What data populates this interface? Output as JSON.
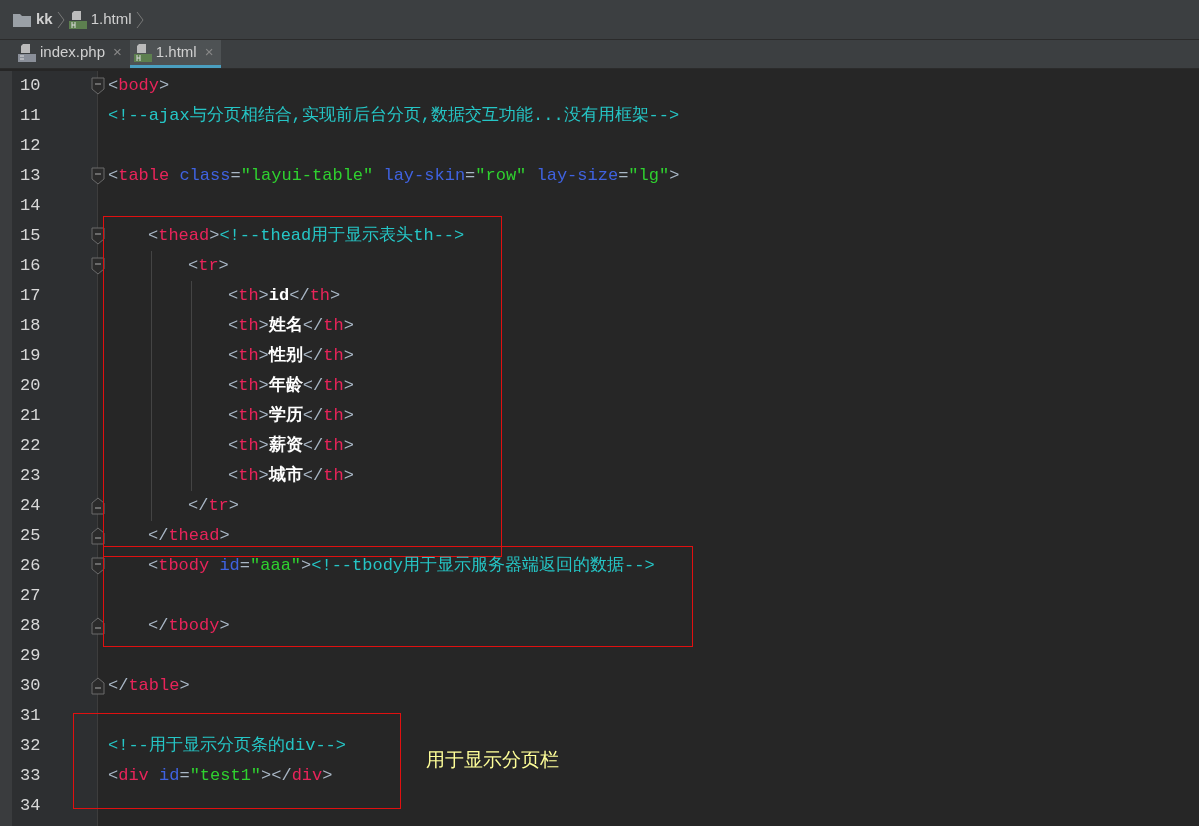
{
  "breadcrumb": [
    {
      "kind": "folder",
      "label": "kk"
    },
    {
      "kind": "html",
      "label": "1.html"
    }
  ],
  "tabs": [
    {
      "kind": "php",
      "label": "index.php",
      "close": "×",
      "selected": false
    },
    {
      "kind": "html",
      "label": "1.html",
      "close": "×",
      "selected": true
    }
  ],
  "lines": [
    {
      "kind": "open",
      "n": "10",
      "tokens": [
        {
          "kind": "br",
          "t": "<"
        },
        {
          "kind": "tag",
          "t": "body"
        },
        {
          "kind": "br",
          "t": ">"
        }
      ]
    },
    {
      "kind": "plain",
      "n": "11",
      "tokens": [
        {
          "kind": "comment",
          "t": "<!--ajax与分页相结合,实现前后台分页,数据交互功能...没有用框架-->"
        }
      ]
    },
    {
      "kind": "plain",
      "n": "12"
    },
    {
      "kind": "open",
      "n": "13",
      "tokens": [
        {
          "kind": "br",
          "t": "<"
        },
        {
          "kind": "tag",
          "t": "table "
        },
        {
          "kind": "attr",
          "t": "class"
        },
        {
          "kind": "br",
          "t": "="
        },
        {
          "kind": "str",
          "t": "\"layui-table\" "
        },
        {
          "kind": "attr",
          "t": "lay-skin"
        },
        {
          "kind": "br",
          "t": "="
        },
        {
          "kind": "str",
          "t": "\"row\" "
        },
        {
          "kind": "attr",
          "t": "lay-size"
        },
        {
          "kind": "br",
          "t": "="
        },
        {
          "kind": "str",
          "t": "\"lg\""
        },
        {
          "kind": "br",
          "t": ">"
        }
      ],
      "children": [
        {
          "kind": "plain",
          "n": "14"
        },
        {
          "kind": "box",
          "lines": [
            {
              "kind": "open",
              "n": "15",
              "tokens": [
                {
                  "kind": "br",
                  "t": "<"
                },
                {
                  "kind": "tag",
                  "t": "thead"
                },
                {
                  "kind": "br",
                  "t": ">"
                },
                {
                  "kind": "comment",
                  "t": "<!--thead用于显示表头th-->"
                }
              ],
              "children": [
                {
                  "kind": "open",
                  "n": "16",
                  "tokens": [
                    {
                      "kind": "br",
                      "t": "<"
                    },
                    {
                      "kind": "tag",
                      "t": "tr"
                    },
                    {
                      "kind": "br",
                      "t": ">"
                    }
                  ],
                  "children": [
                    {
                      "kind": "plain",
                      "n": "17",
                      "tokens": [
                        {
                          "kind": "br",
                          "t": "<"
                        },
                        {
                          "kind": "tag",
                          "t": "th"
                        },
                        {
                          "kind": "br",
                          "t": ">"
                        },
                        {
                          "kind": "text",
                          "t": "id"
                        },
                        {
                          "kind": "br",
                          "t": "</"
                        },
                        {
                          "kind": "tag",
                          "t": "th"
                        },
                        {
                          "kind": "br",
                          "t": ">"
                        }
                      ]
                    },
                    {
                      "kind": "plain",
                      "n": "18",
                      "tokens": [
                        {
                          "kind": "br",
                          "t": "<"
                        },
                        {
                          "kind": "tag",
                          "t": "th"
                        },
                        {
                          "kind": "br",
                          "t": ">"
                        },
                        {
                          "kind": "text",
                          "t": "姓名"
                        },
                        {
                          "kind": "br",
                          "t": "</"
                        },
                        {
                          "kind": "tag",
                          "t": "th"
                        },
                        {
                          "kind": "br",
                          "t": ">"
                        }
                      ]
                    },
                    {
                      "kind": "plain",
                      "n": "19",
                      "tokens": [
                        {
                          "kind": "br",
                          "t": "<"
                        },
                        {
                          "kind": "tag",
                          "t": "th"
                        },
                        {
                          "kind": "br",
                          "t": ">"
                        },
                        {
                          "kind": "text",
                          "t": "性别"
                        },
                        {
                          "kind": "br",
                          "t": "</"
                        },
                        {
                          "kind": "tag",
                          "t": "th"
                        },
                        {
                          "kind": "br",
                          "t": ">"
                        }
                      ]
                    },
                    {
                      "kind": "plain",
                      "n": "20",
                      "tokens": [
                        {
                          "kind": "br",
                          "t": "<"
                        },
                        {
                          "kind": "tag",
                          "t": "th"
                        },
                        {
                          "kind": "br",
                          "t": ">"
                        },
                        {
                          "kind": "text",
                          "t": "年龄"
                        },
                        {
                          "kind": "br",
                          "t": "</"
                        },
                        {
                          "kind": "tag",
                          "t": "th"
                        },
                        {
                          "kind": "br",
                          "t": ">"
                        }
                      ]
                    },
                    {
                      "kind": "plain",
                      "n": "21",
                      "tokens": [
                        {
                          "kind": "br",
                          "t": "<"
                        },
                        {
                          "kind": "tag",
                          "t": "th"
                        },
                        {
                          "kind": "br",
                          "t": ">"
                        },
                        {
                          "kind": "text",
                          "t": "学历"
                        },
                        {
                          "kind": "br",
                          "t": "</"
                        },
                        {
                          "kind": "tag",
                          "t": "th"
                        },
                        {
                          "kind": "br",
                          "t": ">"
                        }
                      ]
                    },
                    {
                      "kind": "plain",
                      "n": "22",
                      "tokens": [
                        {
                          "kind": "br",
                          "t": "<"
                        },
                        {
                          "kind": "tag",
                          "t": "th"
                        },
                        {
                          "kind": "br",
                          "t": ">"
                        },
                        {
                          "kind": "text",
                          "t": "薪资"
                        },
                        {
                          "kind": "br",
                          "t": "</"
                        },
                        {
                          "kind": "tag",
                          "t": "th"
                        },
                        {
                          "kind": "br",
                          "t": ">"
                        }
                      ]
                    },
                    {
                      "kind": "plain",
                      "n": "23",
                      "tokens": [
                        {
                          "kind": "br",
                          "t": "<"
                        },
                        {
                          "kind": "tag",
                          "t": "th"
                        },
                        {
                          "kind": "br",
                          "t": ">"
                        },
                        {
                          "kind": "text",
                          "t": "城市"
                        },
                        {
                          "kind": "br",
                          "t": "</"
                        },
                        {
                          "kind": "tag",
                          "t": "th"
                        },
                        {
                          "kind": "br",
                          "t": ">"
                        }
                      ]
                    }
                  ]
                },
                {
                  "kind": "close",
                  "n": "24",
                  "tokens": [
                    {
                      "kind": "br",
                      "t": "</"
                    },
                    {
                      "kind": "tag",
                      "t": "tr"
                    },
                    {
                      "kind": "br",
                      "t": ">"
                    }
                  ]
                }
              ]
            },
            {
              "kind": "close",
              "n": "25",
              "tokens": [
                {
                  "kind": "br",
                  "t": "</"
                },
                {
                  "kind": "tag",
                  "t": "thead"
                },
                {
                  "kind": "br",
                  "t": ">"
                }
              ]
            }
          ]
        },
        {
          "kind": "box",
          "lines": [
            {
              "kind": "open",
              "n": "26",
              "tokens": [
                {
                  "kind": "br",
                  "t": "<"
                },
                {
                  "kind": "tag",
                  "t": "tbody "
                },
                {
                  "kind": "attr",
                  "t": "id"
                },
                {
                  "kind": "br",
                  "t": "="
                },
                {
                  "kind": "str",
                  "t": "\"aaa\""
                },
                {
                  "kind": "br",
                  "t": ">"
                },
                {
                  "kind": "comment",
                  "t": "<!--tbody用于显示服务器端返回的数据-->"
                }
              ]
            },
            {
              "kind": "plain",
              "n": "27"
            },
            {
              "kind": "close",
              "n": "28",
              "tokens": [
                {
                  "kind": "br",
                  "t": "</"
                },
                {
                  "kind": "tag",
                  "t": "tbody"
                },
                {
                  "kind": "br",
                  "t": ">"
                }
              ]
            }
          ]
        },
        {
          "kind": "plain",
          "n": "29"
        }
      ]
    },
    {
      "kind": "close",
      "n": "30",
      "tokens": [
        {
          "kind": "br",
          "t": "</"
        },
        {
          "kind": "tag",
          "t": "table"
        },
        {
          "kind": "br",
          "t": ">"
        }
      ]
    },
    {
      "kind": "plain",
      "n": "31"
    },
    {
      "kind": "box",
      "note": "用于显示分页栏",
      "lines": [
        {
          "kind": "plain",
          "n": "32",
          "tokens": [
            {
              "kind": "comment",
              "t": "<!--用于显示分页条的div-->"
            }
          ]
        },
        {
          "kind": "plain",
          "n": "33",
          "tokens": [
            {
              "kind": "br",
              "t": "<"
            },
            {
              "kind": "tag",
              "t": "div "
            },
            {
              "kind": "attr",
              "t": "id"
            },
            {
              "kind": "br",
              "t": "="
            },
            {
              "kind": "str",
              "t": "\"test1\""
            },
            {
              "kind": "br",
              "t": "></"
            },
            {
              "kind": "tag",
              "t": "div"
            },
            {
              "kind": "br",
              "t": ">"
            }
          ]
        }
      ]
    },
    {
      "kind": "plain",
      "n": "34"
    }
  ]
}
